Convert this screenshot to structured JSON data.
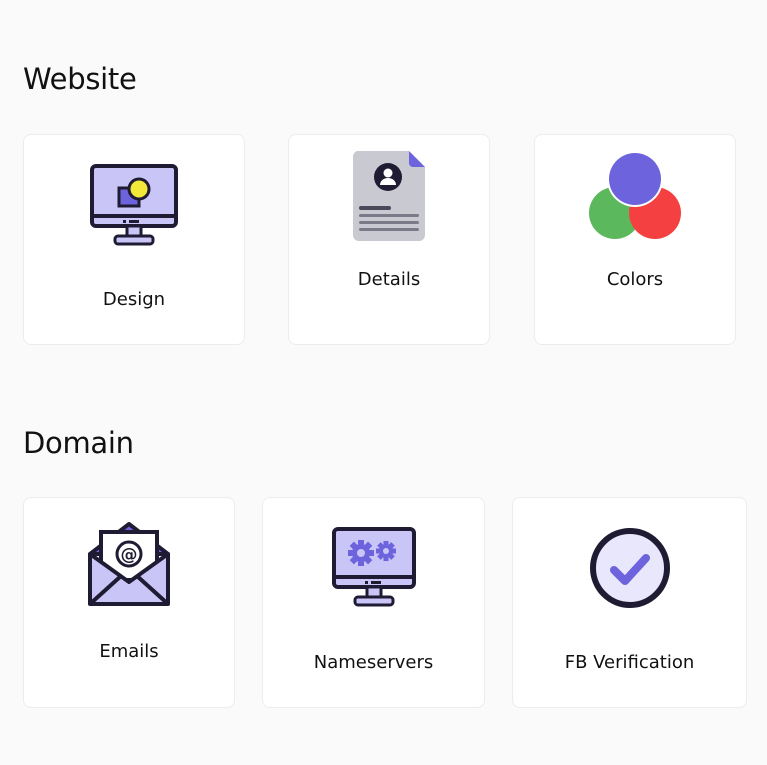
{
  "sections": {
    "website": {
      "title": "Website",
      "cards": [
        {
          "label": "Design",
          "icon": "monitor-design-icon"
        },
        {
          "label": "Details",
          "icon": "document-profile-icon"
        },
        {
          "label": "Colors",
          "icon": "color-circles-icon"
        }
      ]
    },
    "domain": {
      "title": "Domain",
      "cards": [
        {
          "label": "Emails",
          "icon": "envelope-at-icon"
        },
        {
          "label": "Nameservers",
          "icon": "monitor-gears-icon"
        },
        {
          "label": "FB Verification",
          "icon": "check-circle-icon"
        }
      ]
    }
  },
  "colors": {
    "accent": "#6c63dd",
    "accent_light": "#c9c6f7",
    "outline": "#1f1b33",
    "yellow": "#f2e83a",
    "green": "#5cb85c",
    "red": "#f44040",
    "card_bg": "#ffffff",
    "page_bg": "#fafafa"
  }
}
